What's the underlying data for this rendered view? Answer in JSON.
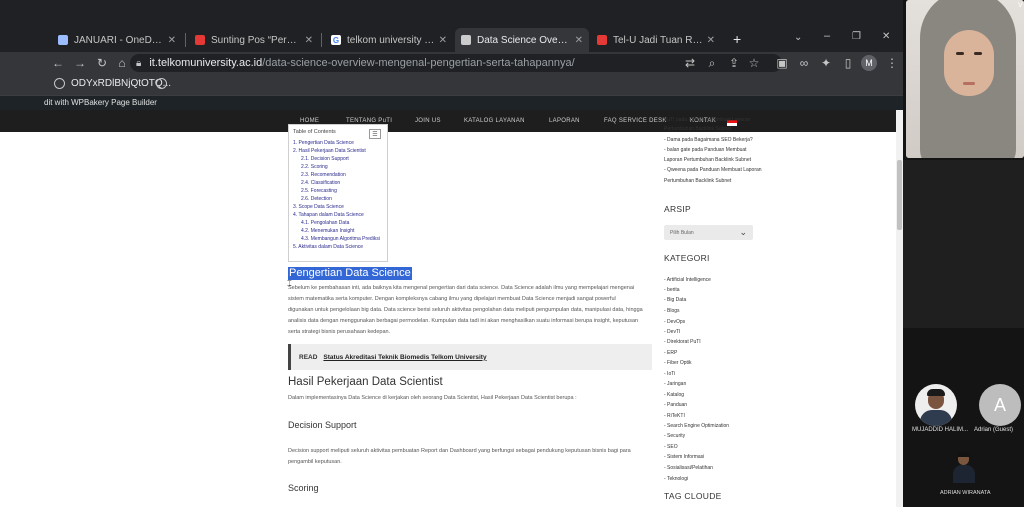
{
  "browser": {
    "tabs": [
      {
        "title": "JANUARI - OneDrive",
        "icon": "onedrive-icon",
        "color": "#9bbcff"
      },
      {
        "title": "Sunting Pos “Perancangan",
        "icon": "telu-icon",
        "color": "#e53935"
      },
      {
        "title": "telkom university - Penel",
        "icon": "google-icon",
        "color": "#ffffff"
      },
      {
        "title": "Data Science Overview : M",
        "icon": "site-icon",
        "color": "#cccccc"
      },
      {
        "title": "Tel-U Jadi Tuan Rumah W",
        "icon": "telu-icon",
        "color": "#e53935"
      }
    ],
    "close_glyph": "✕",
    "new_tab_glyph": "+",
    "url_host": "it.telkomuniversity.ac.id",
    "url_path": "/data-science-overview-mengenal-pengertian-serta-tahapannya/",
    "profile_initial": "M",
    "bookmark": "ODYxRDlBNjQtOTQ..."
  },
  "wp_admin_bar": {
    "text": "dit with WPBakery Page Builder"
  },
  "site_nav": {
    "items": [
      "HOME",
      "TENTANG PuTI",
      "JOIN US",
      "KATALOG LAYANAN",
      "LAPORAN",
      "FAQ SERVICE DESK",
      "KONTAK"
    ]
  },
  "toc": {
    "header": "Table of Contents",
    "toggle": "☰",
    "items": [
      {
        "text": "1. Pengertian Data Science",
        "sub": false
      },
      {
        "text": "2. Hasil Pekerjaan Data Scientist",
        "sub": false
      },
      {
        "text": "2.1. Decision Support",
        "sub": true
      },
      {
        "text": "2.2. Scoring",
        "sub": true
      },
      {
        "text": "2.3. Recomendation",
        "sub": true
      },
      {
        "text": "2.4. Classification",
        "sub": true
      },
      {
        "text": "2.5. Forecasting",
        "sub": true
      },
      {
        "text": "2.6. Detection",
        "sub": true
      },
      {
        "text": "3. Scope Data Science",
        "sub": false
      },
      {
        "text": "4. Tahapan dalam Data Science",
        "sub": false
      },
      {
        "text": "4.1. Pengolahan Data",
        "sub": true
      },
      {
        "text": "4.2. Menemukan Insight",
        "sub": true
      },
      {
        "text": "4.3. Membangun Algoritma Prediksi",
        "sub": true
      },
      {
        "text": "5. Aktivitas dalam Data Science",
        "sub": false
      }
    ]
  },
  "article": {
    "section1_title": "Pengertian Data Science",
    "section1_lines": [
      "Sebelum ke pembahasan inti, ada baiknya kita mengenal pengertian dari data science. Data Science adalah ilmu yang mempelajari mengenai",
      "sistem matematika serta komputer. Dengan kompleksnya cabang ilmu yang dipelajari membuat Data Science menjadi sangat powerful",
      "digunakan untuk pengelolaan big data. Data science berisi seluruh aktivitas pengolahan data meliputi pengumpulan data, manipulasi data, hingga",
      "analisis data dengan menggunakan berbagai permodelan. Kumpulan data tadi ini akan menghasilkan suatu informasi berupa insight, keputusan",
      "serta strategi bisnis perusahaan kedepan."
    ],
    "read_label": "READ",
    "read_title": "Status Akreditasi Teknik Biomedis Telkom University",
    "section2_title": "Hasil Pekerjaan Data Scientist",
    "section2_text": "Dalam implementasinya Data Science di kerjakan oleh seorang Data Scientist, Hasil Pekerjaan Data Scientist berupa :",
    "decision_title": "Decision Support",
    "decision_lines": [
      "Decision support meliputi seluruh aktivitas pembuatan Report dan Dashboard yang berfungsi sebagai pendukung keputusan bisnis bagi para",
      "pengambil keputusan."
    ],
    "scoring_title": "Scoring"
  },
  "sidebar": {
    "recent": [
      "PuTI pada Panduan Membuat Laporan",
      "Pertumbuhan Backlink Subnet",
      "- Dama pada Bagaimana SEO Bekerja?",
      "- balan gate pada Panduan Membuat",
      "Laporan Pertumbuhan Backlink Subnet",
      "- Qweena pada Panduan Membuat Laporan",
      "Pertumbuhan Backlink Subnet"
    ],
    "archive_title": "ARSIP",
    "archive_select": "Pilih Bulan",
    "archive_chevron": "⌄",
    "category_title": "KATEGORI",
    "categories": [
      "- Artificial Intelligence",
      "- berita",
      "- Big Data",
      "- Blogs",
      "- DevOps",
      "- DevTI",
      "- Direktorat PuTI",
      "- ERP",
      "- Fiber Optik",
      "- IoTi",
      "- Jaringan",
      "- Katalog",
      "- Panduan",
      "- RiTeKTI",
      "- Search Engine Optimization",
      "- Security",
      "- SEO",
      "- Sistem Informasi",
      "- Sosialisasi/Pelatihan",
      "- Teknologi"
    ],
    "tag_title": "TAG CLOUDE"
  },
  "call": {
    "participants": [
      {
        "name": "MUJADDID HALIM..."
      },
      {
        "name": "Adrian (Guest)",
        "initial": "A"
      }
    ],
    "self_name": "ADRIAN WIRANATA",
    "corner_mark": "V"
  }
}
